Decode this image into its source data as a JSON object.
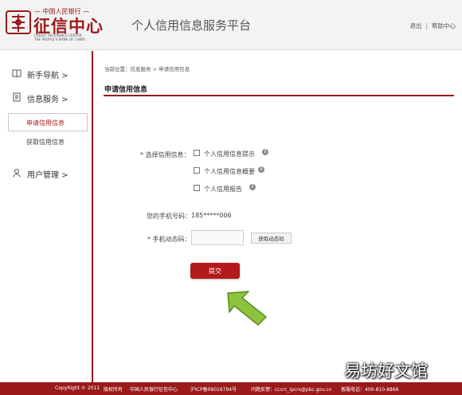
{
  "header": {
    "logo_top": "— 中国人民银行 —",
    "logo_main": "征信中心",
    "logo_en_line1": "CREDIT REFERENCE CENTER",
    "logo_en_line2": "THE PEOPLE'S BANK OF CHINA",
    "platform_title": "个人信用信息服务平台",
    "logout": "退出",
    "separator": "|",
    "help": "帮助中心"
  },
  "sidebar": {
    "guide": "新手导航 >",
    "info_service": "信息服务 >",
    "apply_credit": "申请信用信息",
    "get_credit": "获取信用信息",
    "user_mgmt": "用户管理 >"
  },
  "main": {
    "breadcrumb": "当前位置：信息服务 > 申请信用信息",
    "section_title": "申请信用信息",
    "select_label": "* 选择信用信息：",
    "options": [
      {
        "label": "个人信用信息提示",
        "checked": false
      },
      {
        "label": "个人信用信息概要",
        "checked": false
      },
      {
        "label": "个人信用报告",
        "checked": false
      }
    ],
    "info_glyph": "i",
    "phone_label": "您的手机号码：",
    "phone_value": "185*****006",
    "code_label": "* 手机动态码：",
    "code_value": "",
    "get_code_button": "获取动态码",
    "submit_button": "提交"
  },
  "footer": {
    "copyright": "CopyRight © 2011",
    "rights": "版权所有",
    "org": "中国人民银行征信中心",
    "icp": "沪ICP备08016794号",
    "feedback": "问题反馈：cccrc_ipcrs@pbc.gov.cn",
    "hotline": "客服电话：400-810-8866"
  },
  "watermark": "易坊好文馆",
  "colors": {
    "brand_red": "#9b1a1a",
    "button_red": "#b31b1b",
    "arrow_green": "#8dc43f"
  }
}
